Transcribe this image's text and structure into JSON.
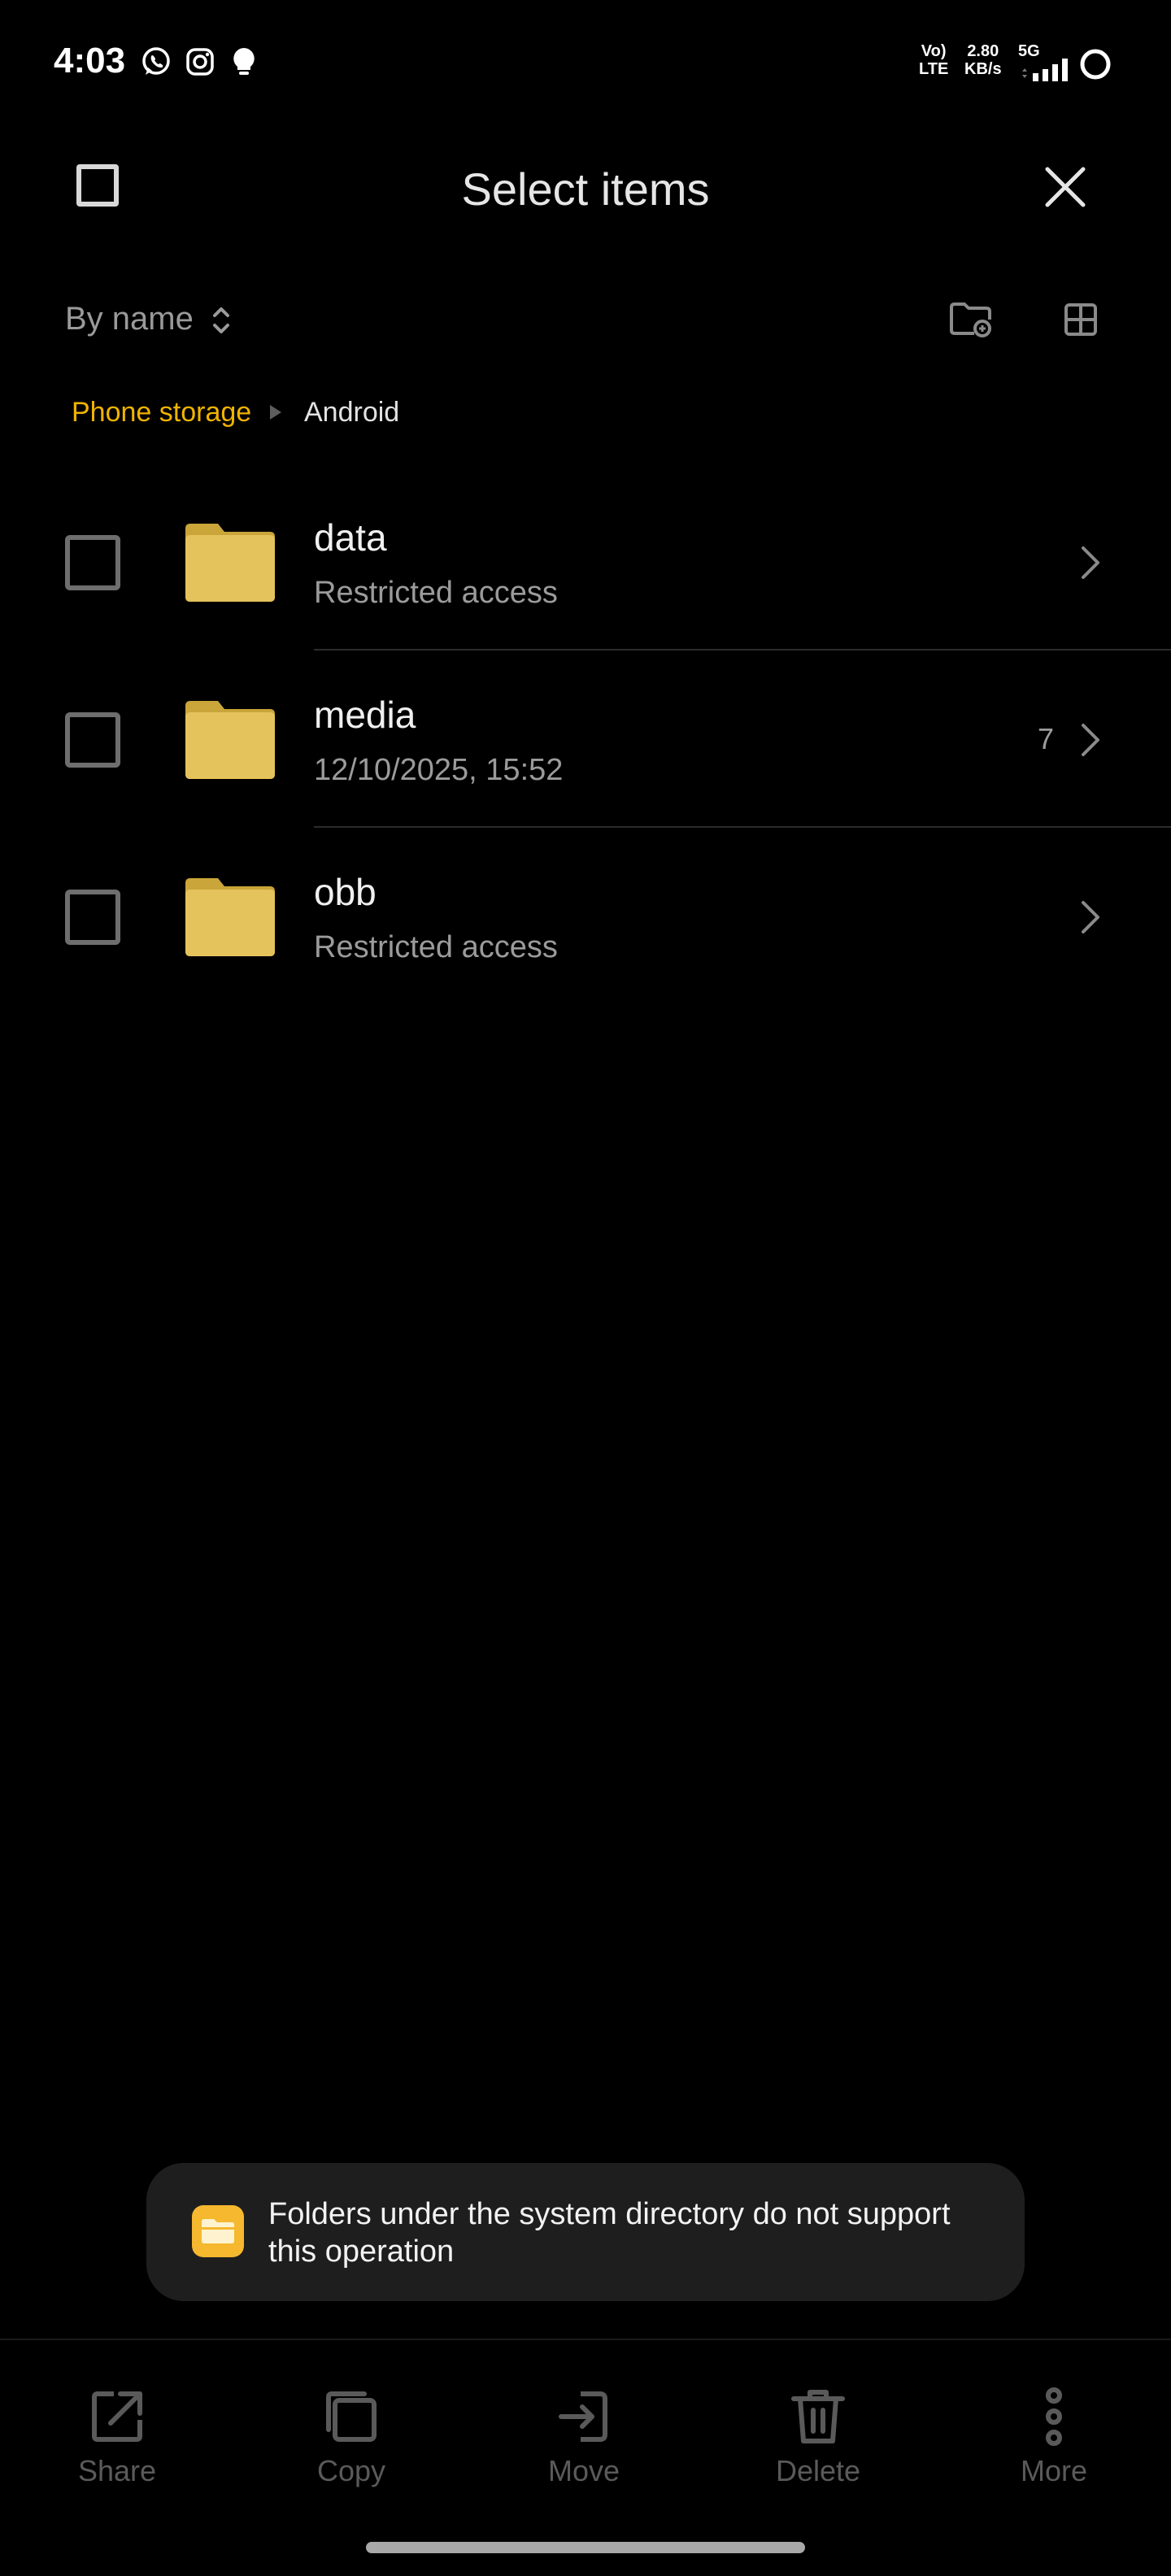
{
  "status_bar": {
    "time": "4:03",
    "app_icons": [
      "whatsapp-icon",
      "instagram-icon",
      "bulb-icon"
    ],
    "network_type_top": "Vo)",
    "network_type_bottom": "LTE",
    "speed_value": "2.80",
    "speed_unit": "KB/s",
    "net_gen": "5G"
  },
  "header": {
    "title": "Select items"
  },
  "toolbar": {
    "sort_label": "By name"
  },
  "breadcrumb": {
    "root": "Phone storage",
    "current": "Android"
  },
  "folders": [
    {
      "name": "data",
      "subtitle": "Restricted access",
      "count": ""
    },
    {
      "name": "media",
      "subtitle": "12/10/2025, 15:52",
      "count": "7"
    },
    {
      "name": "obb",
      "subtitle": "Restricted access",
      "count": ""
    }
  ],
  "toast": {
    "message": "Folders under the system directory do not support this operation"
  },
  "actions": [
    {
      "label": "Share",
      "icon": "share-icon"
    },
    {
      "label": "Copy",
      "icon": "copy-icon"
    },
    {
      "label": "Move",
      "icon": "move-icon"
    },
    {
      "label": "Delete",
      "icon": "delete-icon"
    },
    {
      "label": "More",
      "icon": "more-icon"
    }
  ],
  "colors": {
    "background": "#000000",
    "accent": "#f0b400",
    "folder": "#e5c35c",
    "disabled": "#5a5a5a"
  }
}
